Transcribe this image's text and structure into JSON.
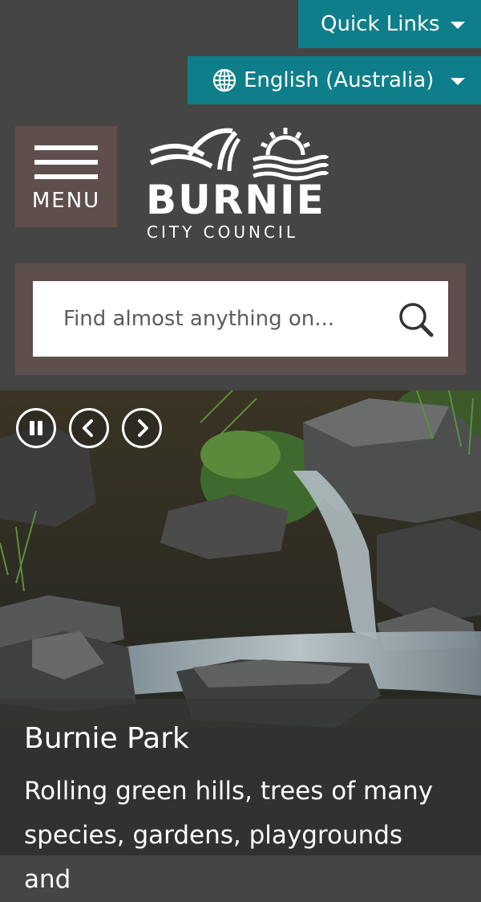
{
  "header": {
    "quick_links_label": "Quick Links",
    "language_label": "English (Australia)",
    "menu_label": "MENU"
  },
  "logo": {
    "name": "BURNIE",
    "subtitle": "CITY  COUNCIL"
  },
  "search": {
    "placeholder": "Find almost anything on..."
  },
  "hero": {
    "slide_title": "Burnie Park",
    "slide_text": "Rolling green hills, trees of many species, gardens, playgrounds and"
  },
  "colors": {
    "header_bg": "#464545",
    "accent_teal": "#0e7f8a",
    "panel_brown": "#5e4f4d"
  },
  "icons": {
    "globe": "globe-icon",
    "caret": "caret-down-icon",
    "search": "search-icon",
    "pause": "pause-icon",
    "prev": "chevron-left-icon",
    "next": "chevron-right-icon"
  }
}
